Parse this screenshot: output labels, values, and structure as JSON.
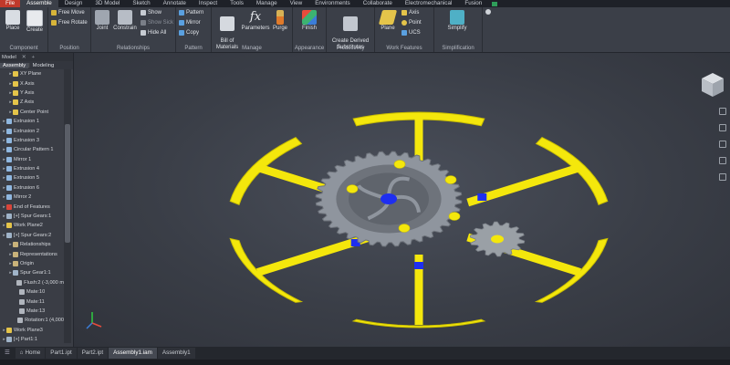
{
  "menu_tabs": [
    "File",
    "Assemble",
    "Design",
    "3D Model",
    "Sketch",
    "Annotate",
    "Inspect",
    "Tools",
    "Manage",
    "View",
    "Environments",
    "Collaborate",
    "Electromechanical",
    "Fusion"
  ],
  "ribbon": {
    "component": {
      "title": "Component",
      "place": "Place",
      "create": "Create"
    },
    "position": {
      "title": "Position",
      "free_move": "Free Move",
      "free_rotate": "Free Rotate"
    },
    "relationships": {
      "title": "Relationships",
      "joint": "Joint",
      "constrain": "Constrain",
      "show": "Show",
      "show_sick": "Show Sick",
      "hide_all": "Hide All"
    },
    "pattern": {
      "title": "Pattern",
      "pattern": "Pattern",
      "mirror": "Mirror",
      "copy": "Copy"
    },
    "manage": {
      "title": "Manage",
      "bom": "Bill of\nMaterials",
      "parameters": "Parameters",
      "purge": "Purge"
    },
    "appearance": {
      "title": "Appearance",
      "finish": "Finish"
    },
    "productivity": {
      "title": "Productivity",
      "create_derived": "Create Derived\nSubstitutes"
    },
    "work_features": {
      "title": "Work Features",
      "plane": "Plane",
      "axis": "Axis",
      "point": "Point",
      "ucs": "UCS"
    },
    "simplification": {
      "title": "Simplification",
      "simplify": "Simplify"
    }
  },
  "browser": {
    "header": "Model",
    "tabs": [
      "Assembly",
      "Modeling"
    ],
    "nodes": [
      {
        "label": "XY Plane",
        "indent": 1,
        "icon": "plane"
      },
      {
        "label": "X Axis",
        "indent": 1,
        "icon": "axis"
      },
      {
        "label": "Y Axis",
        "indent": 1,
        "icon": "axis"
      },
      {
        "label": "Z Axis",
        "indent": 1,
        "icon": "axis"
      },
      {
        "label": "Center Point",
        "indent": 1,
        "icon": "point"
      },
      {
        "label": "Extrusion 1",
        "indent": 0,
        "icon": "feature"
      },
      {
        "label": "Extrusion 2",
        "indent": 0,
        "icon": "feature"
      },
      {
        "label": "Extrusion 3",
        "indent": 0,
        "icon": "feature"
      },
      {
        "label": "Circular Pattern 1",
        "indent": 0,
        "icon": "feature"
      },
      {
        "label": "Mirror 1",
        "indent": 0,
        "icon": "feature"
      },
      {
        "label": "Extrusion 4",
        "indent": 0,
        "icon": "feature"
      },
      {
        "label": "Extrusion 5",
        "indent": 0,
        "icon": "feature"
      },
      {
        "label": "Extrusion 6",
        "indent": 0,
        "icon": "feature"
      },
      {
        "label": "Mirror 2",
        "indent": 0,
        "icon": "feature"
      },
      {
        "label": "End of Features",
        "indent": 0,
        "icon": "end"
      },
      {
        "label": "[+] Spur Gears:1",
        "indent": 0,
        "icon": "part"
      },
      {
        "label": "Work Plane2",
        "indent": 0,
        "icon": "plane"
      },
      {
        "label": "[+] Spur Gears:2",
        "indent": 0,
        "icon": "part"
      },
      {
        "label": "Relationships",
        "indent": 1,
        "icon": "folder"
      },
      {
        "label": "Representations",
        "indent": 1,
        "icon": "folder"
      },
      {
        "label": "Origin",
        "indent": 1,
        "icon": "folder"
      },
      {
        "label": "Spur Gear1:1",
        "indent": 1,
        "icon": "part"
      },
      {
        "label": "Flush:2 (-3,000 m",
        "indent": 2,
        "icon": "constraint"
      },
      {
        "label": "Mate:10",
        "indent": 2,
        "icon": "constraint"
      },
      {
        "label": "Mate:11",
        "indent": 2,
        "icon": "constraint"
      },
      {
        "label": "Mate:13",
        "indent": 2,
        "icon": "constraint"
      },
      {
        "label": "Rotation:1 (4,000",
        "indent": 2,
        "icon": "constraint"
      },
      {
        "label": "Work Plane3",
        "indent": 0,
        "icon": "plane"
      },
      {
        "label": "[+] Part1:1",
        "indent": 0,
        "icon": "part"
      }
    ]
  },
  "doc_tabs": [
    {
      "label": "Home",
      "active": false,
      "icon": "home-icon"
    },
    {
      "label": "Part1.ipt",
      "active": false
    },
    {
      "label": "Part2.ipt",
      "active": false
    },
    {
      "label": "Assembly1.iam",
      "active": true
    },
    {
      "label": "Assembly1",
      "active": false
    }
  ],
  "colors": {
    "ring": "#f4e70c",
    "ring_edge": "#c9be00",
    "blue": "#1e2ef0",
    "gear": "#8f959e",
    "gear_dark": "#6e737b",
    "small_gear": "#9aa0a6",
    "accent": "#c0392b"
  }
}
